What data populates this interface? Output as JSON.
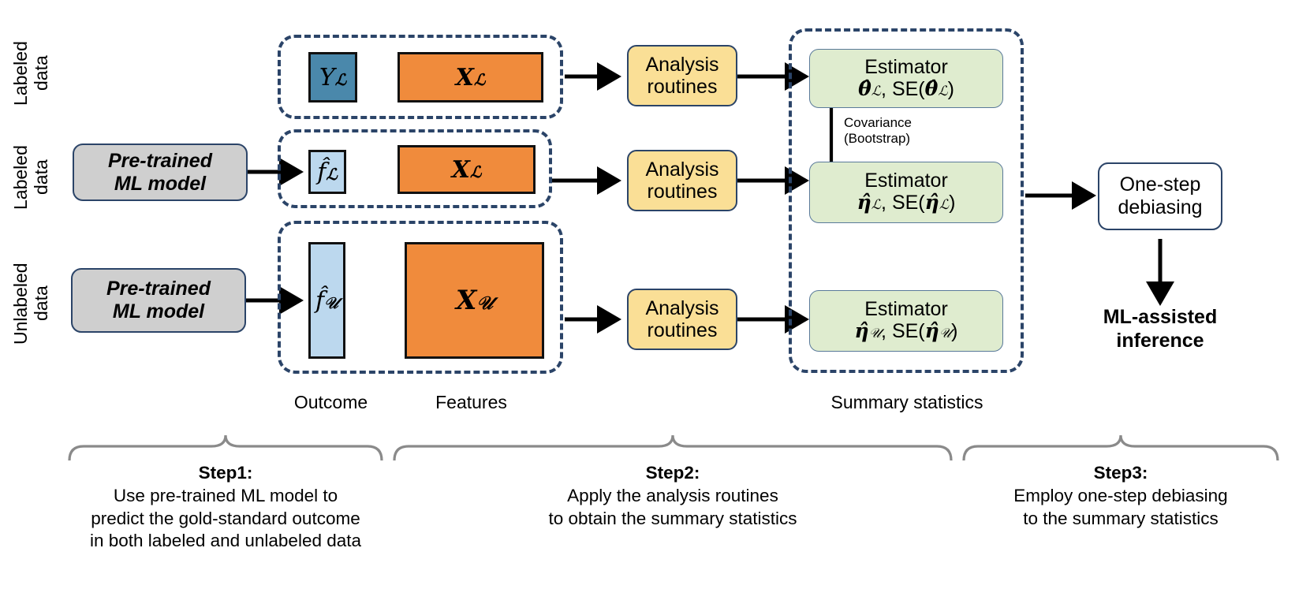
{
  "rows": [
    {
      "label": "Labeled\ndata"
    },
    {
      "label": "Labeled\ndata"
    },
    {
      "label": "Unlabeled\ndata"
    }
  ],
  "ml_model": {
    "label": "Pre-trained\nML model"
  },
  "matrices": {
    "y_labeled": {
      "symbol": "Y",
      "sub": "ℒ",
      "color": "#4a88ab"
    },
    "x_labeled_1": {
      "symbol": "X",
      "sub": "ℒ",
      "color": "#f08b3c"
    },
    "f_labeled": {
      "symbol": "f̂",
      "sub": "ℒ",
      "color": "#bcd8ee"
    },
    "x_labeled_2": {
      "symbol": "X",
      "sub": "ℒ",
      "color": "#f08b3c"
    },
    "f_unlabeled": {
      "symbol": "f̂",
      "sub": "𝒰",
      "color": "#bcd8ee"
    },
    "x_unlabeled": {
      "symbol": "X",
      "sub": "𝒰",
      "color": "#f08b3c"
    }
  },
  "analysis": {
    "label": "Analysis\nroutines"
  },
  "estimators": [
    {
      "title": "Estimator",
      "stat": "θ̂",
      "sub": "ℒ",
      "se_prefix": "SE(",
      "se_suffix": ")"
    },
    {
      "title": "Estimator",
      "stat": "η̂",
      "sub": "ℒ",
      "se_prefix": "SE(",
      "se_suffix": ")"
    },
    {
      "title": "Estimator",
      "stat": "η̂",
      "sub": "𝒰",
      "se_prefix": "SE(",
      "se_suffix": ")"
    }
  ],
  "covariance": {
    "label": "Covariance\n(Bootstrap)"
  },
  "one_step": {
    "label": "One-step\ndebiasing"
  },
  "final_output": {
    "label": "ML-assisted\ninference"
  },
  "group_captions": {
    "outcome": "Outcome",
    "features": "Features",
    "summary": "Summary statistics"
  },
  "steps": [
    {
      "head": "Step1:",
      "body": "Use pre-trained ML model to\npredict the gold-standard outcome\nin both labeled and unlabeled data"
    },
    {
      "head": "Step2:",
      "body": "Apply the analysis routines\nto obtain the summary statistics"
    },
    {
      "head": "Step3:",
      "body": "Employ one-step debiasing\nto the summary statistics"
    }
  ],
  "colors": {
    "navy_dash": "#2b4468",
    "teal": "#4a88ab",
    "orange": "#f08b3c",
    "light_blue": "#bcd8ee",
    "yellow": "#fadf96",
    "green": "#dfeccf",
    "gray": "#cfcfcf",
    "brace": "#8a8a8a",
    "arrow": "#000000"
  }
}
